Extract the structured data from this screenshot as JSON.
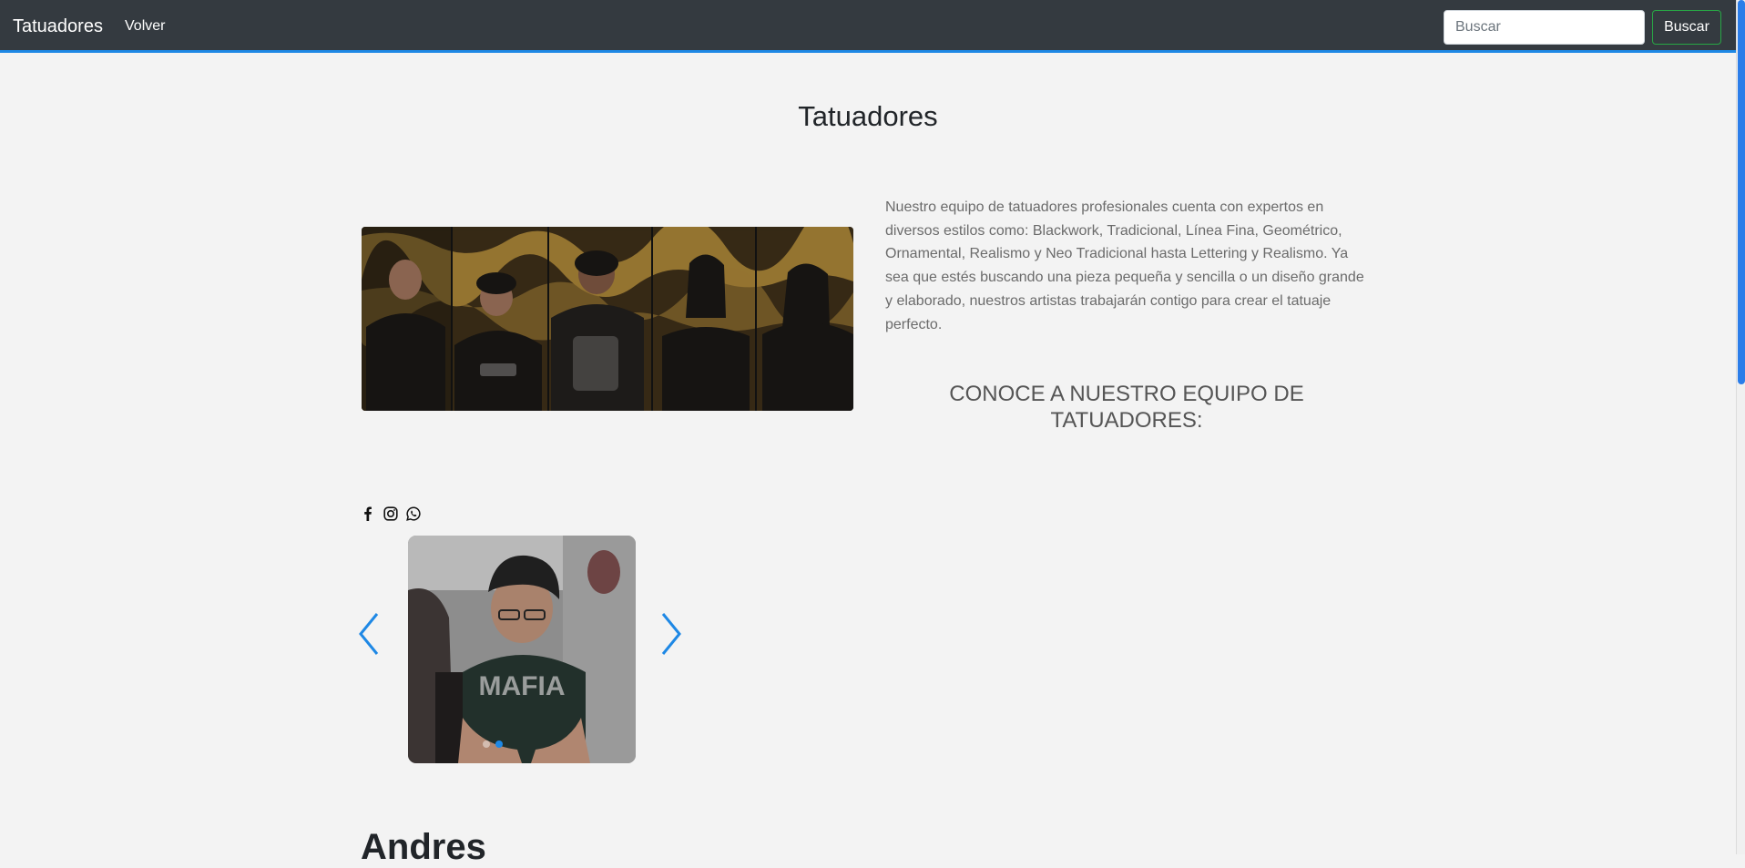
{
  "navbar": {
    "brand": "Tatuadores",
    "back_link": "Volver",
    "search_placeholder": "Buscar",
    "search_button": "Buscar"
  },
  "main": {
    "title": "Tatuadores",
    "intro": "Nuestro equipo de tatuadores profesionales cuenta con expertos en diversos estilos como: Blackwork, Tradicional, Línea Fina, Geométrico, Ornamental, Realismo y Neo Tradicional hasta Lettering y Realismo. Ya sea que estés buscando una pieza pequeña y sencilla o un diseño grande y elaborado, nuestros artistas trabajarán contigo para crear el tatuaje perfecto.",
    "team_heading": "CONOCE A NUESTRO EQUIPO DE TATUADORES:"
  },
  "artist": {
    "name": "Andres",
    "social_icons": [
      "facebook-icon",
      "instagram-icon",
      "whatsapp-icon"
    ],
    "carousel_slides": 2,
    "carousel_active_index": 1
  },
  "colors": {
    "navbar_bg": "#343a40",
    "accent_blue": "#1e88e5",
    "button_border_green": "#28a745",
    "page_bg": "#f3f3f3"
  }
}
